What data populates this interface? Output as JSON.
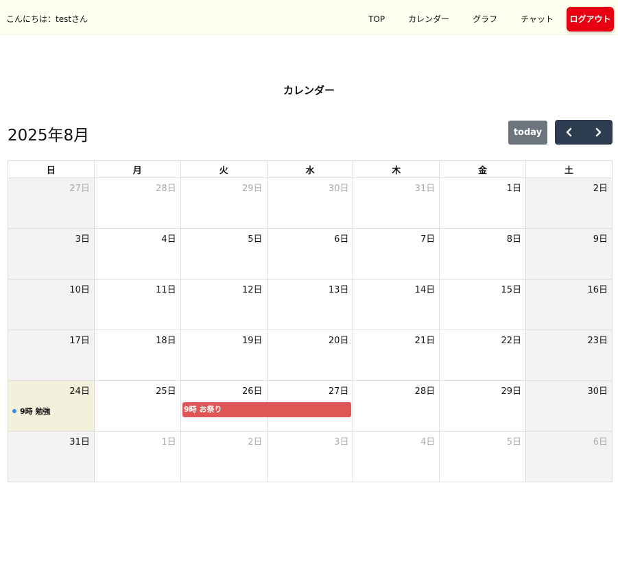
{
  "header": {
    "greeting": "こんにちは：testさん",
    "nav": [
      "TOP",
      "カレンダー",
      "グラフ",
      "チャット"
    ],
    "logout_label": "ログアウト"
  },
  "page": {
    "title": "カレンダー"
  },
  "calendar": {
    "month_title": "2025年8月",
    "today_label": "today",
    "weekdays": [
      "日",
      "月",
      "火",
      "水",
      "木",
      "金",
      "土"
    ],
    "weeks": [
      [
        {
          "label": "27日",
          "other": true
        },
        {
          "label": "28日",
          "other": true
        },
        {
          "label": "29日",
          "other": true
        },
        {
          "label": "30日",
          "other": true
        },
        {
          "label": "31日",
          "other": true
        },
        {
          "label": "1日",
          "other": false
        },
        {
          "label": "2日",
          "other": false
        }
      ],
      [
        {
          "label": "3日",
          "other": false
        },
        {
          "label": "4日",
          "other": false
        },
        {
          "label": "5日",
          "other": false
        },
        {
          "label": "6日",
          "other": false
        },
        {
          "label": "7日",
          "other": false
        },
        {
          "label": "8日",
          "other": false
        },
        {
          "label": "9日",
          "other": false
        }
      ],
      [
        {
          "label": "10日",
          "other": false
        },
        {
          "label": "11日",
          "other": false
        },
        {
          "label": "12日",
          "other": false
        },
        {
          "label": "13日",
          "other": false
        },
        {
          "label": "14日",
          "other": false
        },
        {
          "label": "15日",
          "other": false
        },
        {
          "label": "16日",
          "other": false
        }
      ],
      [
        {
          "label": "17日",
          "other": false
        },
        {
          "label": "18日",
          "other": false
        },
        {
          "label": "19日",
          "other": false
        },
        {
          "label": "20日",
          "other": false
        },
        {
          "label": "21日",
          "other": false
        },
        {
          "label": "22日",
          "other": false
        },
        {
          "label": "23日",
          "other": false
        }
      ],
      [
        {
          "label": "24日",
          "other": false,
          "today": true
        },
        {
          "label": "25日",
          "other": false
        },
        {
          "label": "26日",
          "other": false
        },
        {
          "label": "27日",
          "other": false
        },
        {
          "label": "28日",
          "other": false
        },
        {
          "label": "29日",
          "other": false
        },
        {
          "label": "30日",
          "other": false
        }
      ],
      [
        {
          "label": "31日",
          "other": false
        },
        {
          "label": "1日",
          "other": true
        },
        {
          "label": "2日",
          "other": true
        },
        {
          "label": "3日",
          "other": true
        },
        {
          "label": "4日",
          "other": true
        },
        {
          "label": "5日",
          "other": true
        },
        {
          "label": "6日",
          "other": true
        }
      ]
    ],
    "events": {
      "study": {
        "time": "9時",
        "title": "勉強",
        "color": "#3788d8"
      },
      "festival": {
        "time": "9時",
        "title": "お祭り",
        "color": "#e05555"
      }
    }
  },
  "icons": {
    "prev": "chevron-left-icon",
    "next": "chevron-right-icon"
  }
}
